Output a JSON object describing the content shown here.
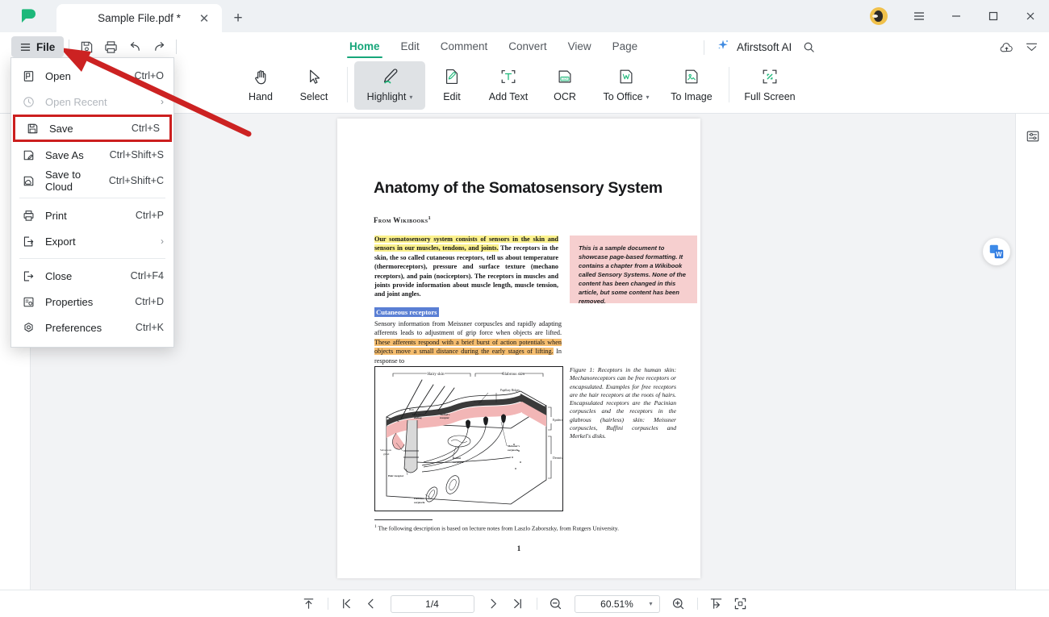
{
  "window": {
    "tab_title": "Sample File.pdf *",
    "tab_close": "✕",
    "new_tab": "+",
    "minimize": "─",
    "maximize": "□",
    "close": "✕",
    "hamburger_icon": "menu-icon",
    "avatar_icon": "user-avatar"
  },
  "quickbar": {
    "file_label": "File",
    "buttons": [
      {
        "name": "save-icon",
        "title": "Save"
      },
      {
        "name": "print-icon",
        "title": "Print"
      },
      {
        "name": "undo-icon",
        "title": "Undo"
      },
      {
        "name": "redo-icon",
        "title": "Redo"
      }
    ]
  },
  "ribbon_tabs": [
    {
      "label": "Home",
      "active": true
    },
    {
      "label": "Edit",
      "active": false
    },
    {
      "label": "Comment",
      "active": false
    },
    {
      "label": "Convert",
      "active": false
    },
    {
      "label": "View",
      "active": false
    },
    {
      "label": "Page",
      "active": false
    }
  ],
  "ribbon_right": {
    "ai_label": "Afirstsoft AI",
    "sparkle_icon": "sparkle-icon",
    "search_icon": "search-icon",
    "cloud_upload_icon": "cloud-upload-icon",
    "collapse_icon": "collapse-ribbon-icon"
  },
  "toolbar": [
    {
      "label": "Hand",
      "icon": "hand-icon",
      "active": false,
      "caret": false
    },
    {
      "label": "Select",
      "icon": "cursor-icon",
      "active": false,
      "caret": false
    },
    {
      "label": "Highlight",
      "icon": "highlight-pen-icon",
      "active": true,
      "caret": true
    },
    {
      "label": "Edit",
      "icon": "edit-page-icon",
      "active": false,
      "caret": false
    },
    {
      "label": "Add Text",
      "icon": "add-text-icon",
      "active": false,
      "caret": false
    },
    {
      "label": "OCR",
      "icon": "ocr-icon",
      "active": false,
      "caret": false
    },
    {
      "label": "To Office",
      "icon": "to-office-icon",
      "active": false,
      "caret": true
    },
    {
      "label": "To Image",
      "icon": "to-image-icon",
      "active": false,
      "caret": false
    },
    {
      "label": "Full Screen",
      "icon": "fullscreen-icon",
      "active": false,
      "caret": false
    }
  ],
  "file_menu": {
    "items": [
      {
        "label": "Open",
        "shortcut": "Ctrl+O",
        "icon": "open-file-icon",
        "disabled": false,
        "submenu": false,
        "highlighted": false
      },
      {
        "label": "Open Recent",
        "shortcut": "",
        "icon": "clock-icon",
        "disabled": true,
        "submenu": true,
        "highlighted": false
      },
      {
        "label": "Save",
        "shortcut": "Ctrl+S",
        "icon": "floppy-disk-icon",
        "disabled": false,
        "submenu": false,
        "highlighted": true
      },
      {
        "label": "Save As",
        "shortcut": "Ctrl+Shift+S",
        "icon": "save-as-icon",
        "disabled": false,
        "submenu": false,
        "highlighted": false
      },
      {
        "label": "Save to Cloud",
        "shortcut": "Ctrl+Shift+C",
        "icon": "save-cloud-icon",
        "disabled": false,
        "submenu": false,
        "highlighted": false
      },
      {
        "label": "Print",
        "shortcut": "Ctrl+P",
        "icon": "printer-icon",
        "disabled": false,
        "submenu": false,
        "highlighted": false
      },
      {
        "label": "Export",
        "shortcut": "",
        "icon": "export-icon",
        "disabled": false,
        "submenu": true,
        "highlighted": false
      },
      {
        "label": "Close",
        "shortcut": "Ctrl+F4",
        "icon": "close-doc-icon",
        "disabled": false,
        "submenu": false,
        "highlighted": false
      },
      {
        "label": "Properties",
        "shortcut": "Ctrl+D",
        "icon": "properties-icon",
        "disabled": false,
        "submenu": false,
        "highlighted": false
      },
      {
        "label": "Preferences",
        "shortcut": "Ctrl+K",
        "icon": "preferences-icon",
        "disabled": false,
        "submenu": false,
        "highlighted": false
      }
    ],
    "submenu_arrow": "›",
    "highlight_color": "#cc1f1f"
  },
  "annotation": {
    "arrow_color": "#cc2222",
    "arrow_target": "file-button"
  },
  "document": {
    "title": "Anatomy of the Somatosensory System",
    "from_line": "From Wikibooks",
    "from_sup": "1",
    "para1_hl_yellow": "Our somatosensory system consists of sensors in the skin and sensors in our muscles, tendons, and joints.",
    "para1_rest": " The receptors in the skin, the so called cutaneous receptors, tell us about temperature (thermoreceptors), pressure and surface texture (mechano receptors), and pain (nociceptors). The receptors in muscles and joints provide information about muscle length, muscle tension, and joint angles.",
    "samplebox_text": "This is a sample document to showcase page-based formatting. It contains a chapter from a Wikibook called Sensory Systems. None of the content has been changed in this article, but some content has been removed.",
    "subhead": "Cutaneous receptors",
    "para2_plain": "Sensory information from Meissner corpuscles and rapidly adapting afferents leads to adjustment of grip force when objects are lifted. ",
    "para2_hl_orange": "These afferents respond with a brief burst of action potentials when objects move a small distance during the early stages of lifting.",
    "para2_tail": " In response to",
    "figure_caption": "Figure 1: Receptors in the human skin: Mechanoreceptors can be free receptors or encapsulated. Examples for free receptors are the hair receptors at the roots of hairs. Encapsulated receptors are the Pacinian corpuscles and the receptors in the glabrous (hairless) skin: Meissner corpuscles, Ruffini corpuscles and Merkel's disks.",
    "footnote_sup": "1",
    "footnote": " The following description is based on lecture notes from Laszlo Zaborszky, from Rutgers University.",
    "page_number": "1",
    "figure_labels": {
      "hairy_skin": "Hairy skin",
      "glabrous_skin": "Glabrous skin",
      "epidermis": "Epidermis",
      "dermis": "Dermis",
      "papillary_ridges": "Papillary Ridges",
      "free_nerve": "Free nerve ending",
      "merkel": "Merkel's receptor",
      "sebaceous": "Sebaceous gland",
      "hair_receptor": "Hair receptor",
      "ruffini": "Ruffini corpuscle",
      "meissner": "Meissner's corpuscle",
      "pacinian": "Pacinian corpuscle"
    }
  },
  "right_panel": {
    "word_fab_icon": "word-convert-icon",
    "properties_icon": "properties-panel-icon"
  },
  "statusbar": {
    "scroll_top_icon": "scroll-to-top-icon",
    "first_page_icon": "first-page-icon",
    "prev_page_icon": "prev-page-icon",
    "page_value": "1/4",
    "next_page_icon": "next-page-icon",
    "last_page_icon": "last-page-icon",
    "zoom_out_icon": "zoom-out-icon",
    "zoom_value": "60.51%",
    "zoom_caret": "▾",
    "zoom_in_icon": "zoom-in-icon",
    "fit_width_icon": "fit-width-icon",
    "fit_page_icon": "fit-page-icon"
  }
}
